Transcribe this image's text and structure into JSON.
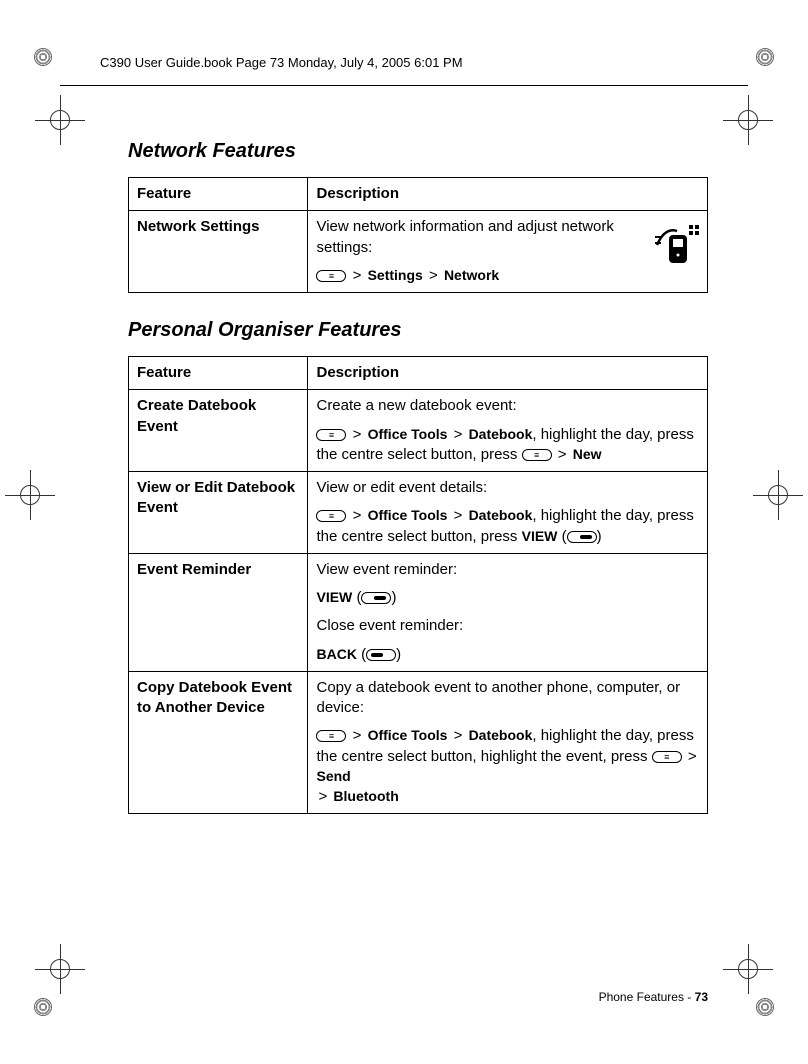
{
  "header": "C390 User Guide.book  Page 73  Monday, July 4, 2005  6:01 PM",
  "section1_title": "Network Features",
  "table_headers": {
    "feature": "Feature",
    "description": "Description"
  },
  "network_table": {
    "row1": {
      "feature": "Network Settings",
      "desc_text": "View network information and adjust network settings:",
      "path_settings": "Settings",
      "path_network": "Network"
    }
  },
  "section2_title": "Personal Organiser Features",
  "organiser_table": {
    "row1": {
      "feature": "Create Datebook Event",
      "desc_text": "Create a new datebook event:",
      "path_office": "Office Tools",
      "path_datebook": "Datebook",
      "desc_text2": ", highlight the day, press the centre select button, press ",
      "path_new": "New"
    },
    "row2": {
      "feature": "View or Edit Datebook Event",
      "desc_text": "View or edit event details:",
      "path_office": "Office Tools",
      "path_datebook": "Datebook",
      "desc_text2": ", highlight the day, press the centre select button, press ",
      "view_label": "VIEW"
    },
    "row3": {
      "feature": "Event Reminder",
      "desc_text": "View event reminder:",
      "view_label": "VIEW",
      "desc_text2": "Close event reminder:",
      "back_label": "BACK"
    },
    "row4": {
      "feature": "Copy Datebook Event to Another Device",
      "desc_text": "Copy a datebook event to another phone, computer, or device:",
      "path_office": "Office Tools",
      "path_datebook": "Datebook",
      "desc_text2": ", highlight the day, press the centre select button, highlight the event, press ",
      "path_send": "Send",
      "path_bluetooth": "Bluetooth"
    }
  },
  "footer": {
    "label": "Phone Features - ",
    "page": "73"
  }
}
